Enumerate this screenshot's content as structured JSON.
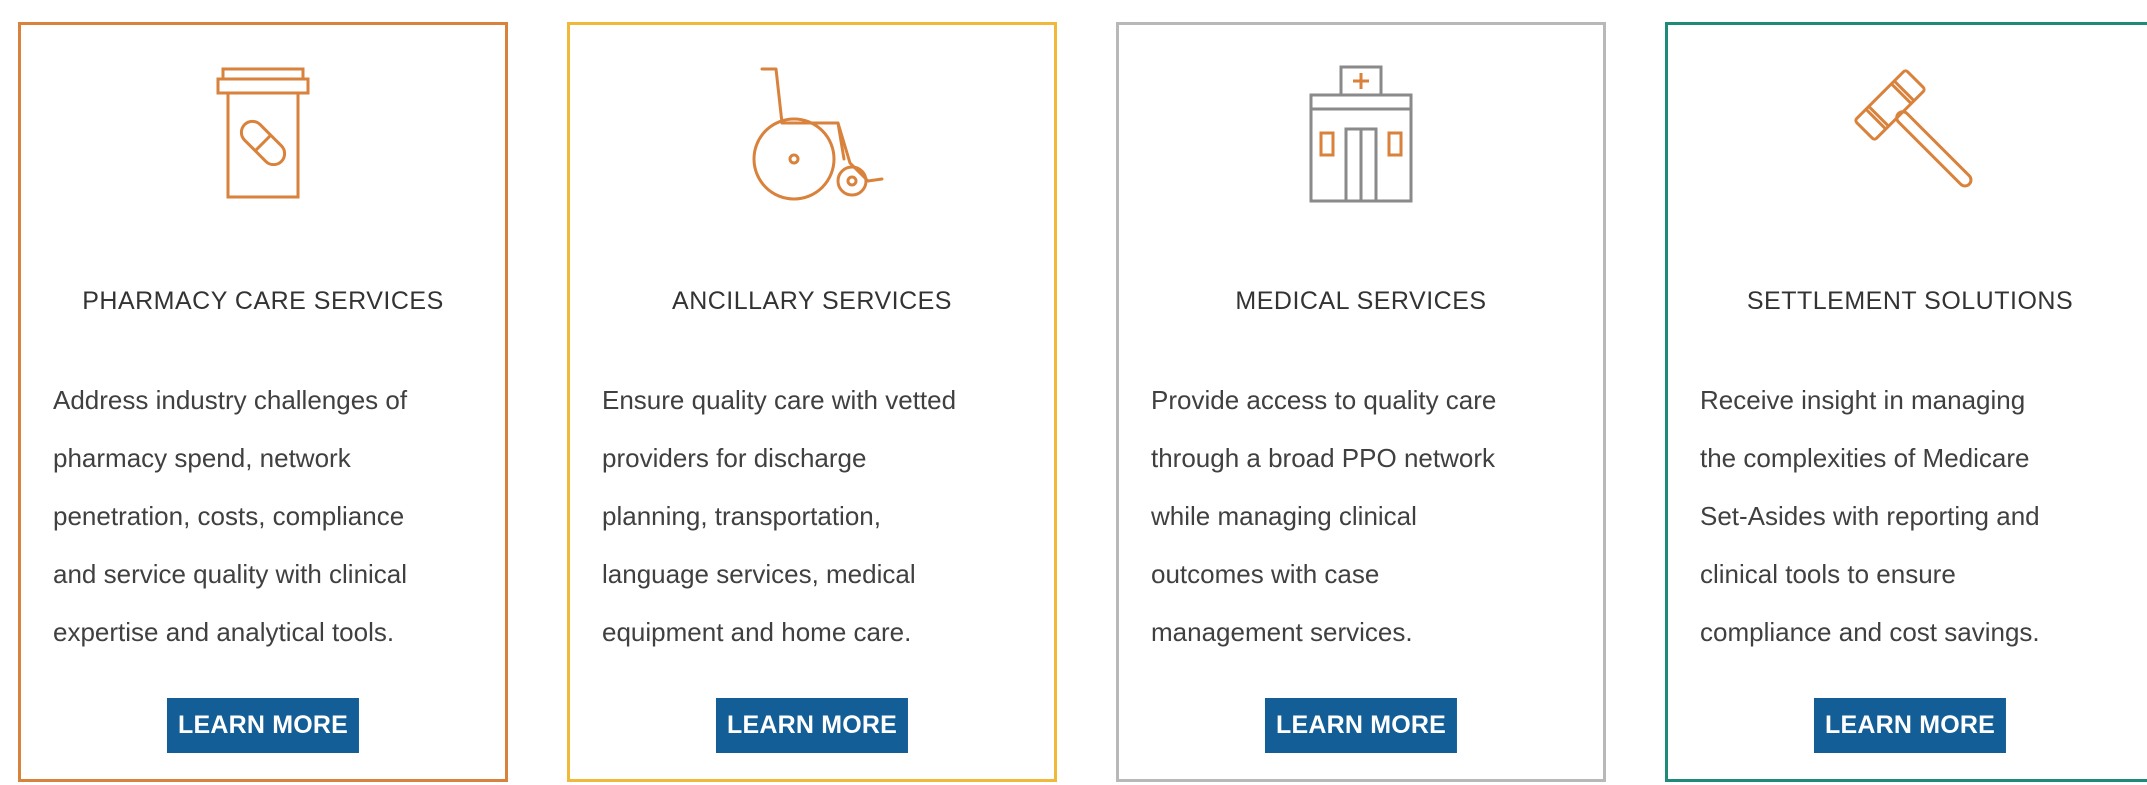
{
  "colors": {
    "pharmacy_border": "#d9823c",
    "ancillary_border": "#f0b93a",
    "medical_border": "#b8b8b8",
    "settlement_border": "#1e8a78",
    "button_bg": "#135e96",
    "icon_orange": "#d9823c",
    "icon_gray": "#8a8a8a"
  },
  "cards": [
    {
      "icon": "pill-bottle-icon",
      "title": "PHARMACY CARE SERVICES",
      "description": "Address industry challenges of\npharmacy spend, network\npenetration, costs, compliance\nand service quality with clinical\nexpertise and analytical tools.",
      "button_label": "LEARN MORE"
    },
    {
      "icon": "wheelchair-icon",
      "title": "ANCILLARY SERVICES",
      "description": "Ensure quality care with vetted\nproviders for discharge\nplanning, transportation,\nlanguage services, medical\nequipment and home care.",
      "button_label": "LEARN MORE"
    },
    {
      "icon": "hospital-icon",
      "title": "MEDICAL SERVICES",
      "description": "Provide access to quality care\nthrough a broad PPO network\nwhile managing clinical\noutcomes with case\nmanagement services.",
      "button_label": "LEARN MORE"
    },
    {
      "icon": "gavel-icon",
      "title": "SETTLEMENT SOLUTIONS",
      "description": "Receive insight in managing\nthe complexities of Medicare\nSet-Asides with reporting and\nclinical tools to ensure\ncompliance and cost savings.",
      "button_label": "LEARN MORE"
    }
  ]
}
